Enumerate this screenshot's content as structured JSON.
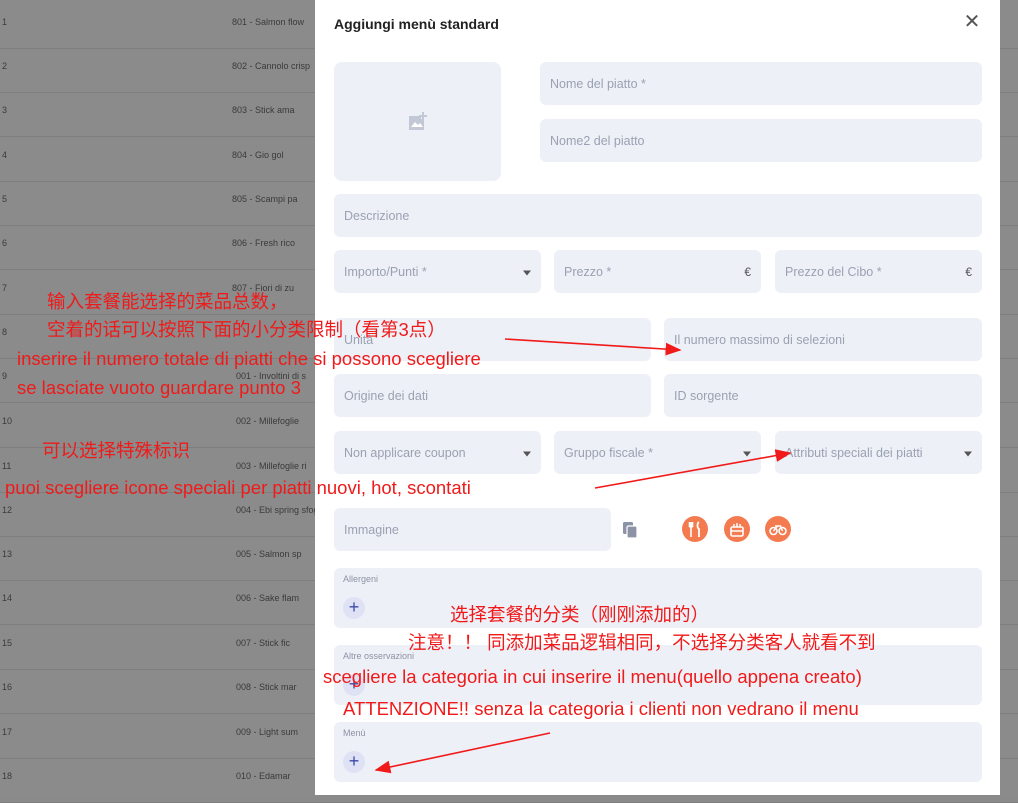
{
  "background_list": {
    "rows": [
      {
        "index": "1",
        "name": "801 - Salmon flow"
      },
      {
        "index": "2",
        "name": "802 - Cannolo crisp"
      },
      {
        "index": "3",
        "name": "803 - Stick ama"
      },
      {
        "index": "4",
        "name": "804 - Gio gol"
      },
      {
        "index": "5",
        "name": "805 - Scampi pa"
      },
      {
        "index": "6",
        "name": "806 - Fresh rico"
      },
      {
        "index": "7",
        "name": "807 - Fiori di zu"
      },
      {
        "index": "8",
        "name": ""
      },
      {
        "index": "9",
        "name": "001 - Involtini di s"
      },
      {
        "index": "10",
        "name": "002 - Millefoglie"
      },
      {
        "index": "11",
        "name": "003 - Millefoglie ri"
      },
      {
        "index": "12",
        "name": "004 - Ebi spring sfog"
      },
      {
        "index": "13",
        "name": "005 - Salmon sp"
      },
      {
        "index": "14",
        "name": "006 - Sake flam"
      },
      {
        "index": "15",
        "name": "007 - Stick fic"
      },
      {
        "index": "16",
        "name": "008 - Stick mar"
      },
      {
        "index": "17",
        "name": "009 - Light sum"
      },
      {
        "index": "18",
        "name": "010 - Edamar"
      }
    ]
  },
  "modal": {
    "title": "Aggiungi menù standard",
    "close_icon": "close-icon",
    "fields": {
      "dish_name": "Nome del piatto *",
      "dish_name2": "Nome2 del piatto",
      "description": "Descrizione",
      "amount_points": "Importo/Punti *",
      "price": "Prezzo *",
      "food_price": "Prezzo del Cibo *",
      "currency": "€",
      "unit": "Unità",
      "max_selections": "Il numero massimo di selezioni",
      "data_origin": "Origine dei dati",
      "source_id": "ID sorgente",
      "no_coupon": "Non applicare coupon",
      "tax_group": "Gruppo fiscale *",
      "special_attributes": "Attributi speciali dei piatti",
      "image": "Immagine"
    },
    "sections": {
      "allergens": "Allergeni",
      "other_notes": "Altre osservazioni",
      "menu": "Menù",
      "add": "+"
    },
    "icon_colors": {
      "accent": "#f47b4f",
      "field_bg": "#eef0f7",
      "plus_bg": "#dfe2f5"
    }
  },
  "annotations": {
    "a1_cn_1": "输入套餐能选择的菜品总数，",
    "a1_cn_2": "空着的话可以按照下面的小分类限制（看第3点）",
    "a1_it_1": "inserire il numero totale di piatti che si possono scegliere",
    "a1_it_2": "se lasciate vuoto guardare punto 3",
    "a2_cn": "可以选择特殊标识",
    "a2_it": "puoi scegliere icone speciali per piatti nuovi, hot, scontati",
    "a3_cn_1": "选择套餐的分类（刚刚添加的）",
    "a3_cn_2": "注意！！ 同添加菜品逻辑相同，不选择分类客人就看不到",
    "a3_it_1": "scegliere la categoria in cui inserire il menu(quello appena creato)",
    "a3_it_2": "ATTENZIONE!! senza la categoria i clienti non vedrano il menu",
    "color": "#f01a1a"
  }
}
